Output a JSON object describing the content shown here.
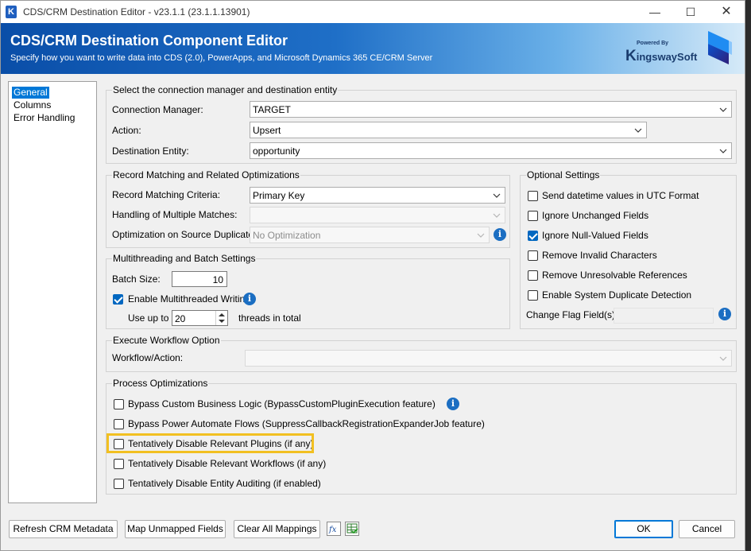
{
  "window": {
    "app_icon_letter": "K",
    "title": "CDS/CRM Destination Editor - v23.1.1 (23.1.1.13901)",
    "controls": {
      "minimize": "—",
      "maximize": "☐",
      "close": "✕"
    }
  },
  "banner": {
    "title": "CDS/CRM Destination Component Editor",
    "subtitle": "Specify how you want to write data into CDS (2.0), PowerApps, and Microsoft Dynamics 365 CE/CRM Server",
    "brand_powered": "Powered By",
    "brand_k": "K",
    "brand_name": "ingswaySoft",
    "colors": {
      "start": "#0a4ea8",
      "end": "#d6eaf8"
    }
  },
  "nav": {
    "items": [
      {
        "label": "General",
        "selected": true
      },
      {
        "label": "Columns",
        "selected": false
      },
      {
        "label": "Error Handling",
        "selected": false
      }
    ]
  },
  "connection": {
    "group_title": "Select the connection manager and destination entity",
    "connection_manager_label": "Connection Manager:",
    "connection_manager_value": "TARGET",
    "action_label": "Action:",
    "action_value": "Upsert",
    "destination_entity_label": "Destination Entity:",
    "destination_entity_value": "opportunity"
  },
  "record_matching": {
    "group_title": "Record Matching and Related Optimizations",
    "criteria_label": "Record Matching Criteria:",
    "criteria_value": "Primary Key",
    "multiple_matches_label": "Handling of Multiple Matches:",
    "multiple_matches_value": "",
    "source_duplicates_label": "Optimization on Source Duplicates:",
    "source_duplicates_value": "No Optimization"
  },
  "optional_settings": {
    "group_title": "Optional Settings",
    "options": [
      {
        "label": "Send datetime values in UTC Format",
        "checked": false
      },
      {
        "label": "Ignore Unchanged Fields",
        "checked": false
      },
      {
        "label": "Ignore Null-Valued Fields",
        "checked": true
      },
      {
        "label": "Remove Invalid Characters",
        "checked": false
      },
      {
        "label": "Remove Unresolvable References",
        "checked": false
      },
      {
        "label": "Enable System Duplicate Detection",
        "checked": false
      }
    ],
    "change_flag_label": "Change Flag Field(s):",
    "change_flag_value": ""
  },
  "multithreading": {
    "group_title": "Multithreading and Batch Settings",
    "batch_size_label": "Batch Size:",
    "batch_size_value": "10",
    "enable_label": "Enable Multithreaded Writing",
    "enable_checked": true,
    "use_up_to_label": "Use up to",
    "threads_value": "20",
    "threads_suffix": "threads in total"
  },
  "workflow": {
    "group_title": "Execute Workflow Option",
    "label": "Workflow/Action:",
    "value": ""
  },
  "process_optimizations": {
    "group_title": "Process Optimizations",
    "options": [
      {
        "label": "Bypass Custom Business Logic (BypassCustomPluginExecution feature)",
        "checked": false
      },
      {
        "label": "Bypass Power Automate Flows (SuppressCallbackRegistrationExpanderJob feature)",
        "checked": false
      },
      {
        "label": "Tentatively Disable Relevant Plugins (if any)",
        "checked": false
      },
      {
        "label": "Tentatively Disable Relevant Workflows (if any)",
        "checked": false
      },
      {
        "label": "Tentatively Disable Entity Auditing (if enabled)",
        "checked": false
      }
    ],
    "highlight_color": "#f2c021"
  },
  "icons": {
    "info": "i",
    "fx": "fx"
  },
  "footer": {
    "refresh_label": "Refresh CRM Metadata",
    "map_unmapped_label": "Map Unmapped Fields",
    "clear_mappings_label": "Clear All Mappings",
    "ok_label": "OK",
    "cancel_label": "Cancel"
  }
}
